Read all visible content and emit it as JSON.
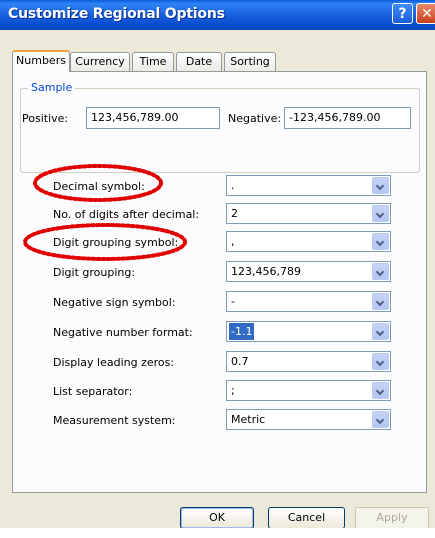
{
  "window": {
    "title": "Customize Regional Options",
    "help_label": "?",
    "close_label": "✕"
  },
  "tabs": [
    {
      "label": "Numbers",
      "active": true
    },
    {
      "label": "Currency",
      "active": false
    },
    {
      "label": "Time",
      "active": false
    },
    {
      "label": "Date",
      "active": false
    },
    {
      "label": "Sorting",
      "active": false
    }
  ],
  "sample": {
    "title": "Sample",
    "positive_label": "Positive:",
    "positive_value": "123,456,789.00",
    "negative_label": "Negative:",
    "negative_value": "-123,456,789.00"
  },
  "settings": [
    {
      "label": "Decimal symbol:",
      "value": "."
    },
    {
      "label": "No. of digits after decimal:",
      "value": "2"
    },
    {
      "label": "Digit grouping symbol:",
      "value": ","
    },
    {
      "label": "Digit grouping:",
      "value": "123,456,789"
    },
    {
      "label": "Negative sign symbol:",
      "value": "-"
    },
    {
      "label": "Negative number format:",
      "value": "-1.1",
      "selected": true
    },
    {
      "label": "Display leading zeros:",
      "value": "0.7"
    },
    {
      "label": "List separator:",
      "value": ";"
    },
    {
      "label": "Measurement system:",
      "value": "Metric"
    }
  ],
  "buttons": {
    "ok": "OK",
    "cancel": "Cancel",
    "apply": "Apply"
  },
  "icons": {
    "dropdown": "chevron-down-icon",
    "help": "help-icon",
    "close": "close-icon"
  },
  "colors": {
    "titlebar": "#0a5ddb",
    "group_title": "#0046d5",
    "selection": "#316ac5",
    "annotation": "#e00000",
    "tab_highlight": "#f2a33a"
  }
}
